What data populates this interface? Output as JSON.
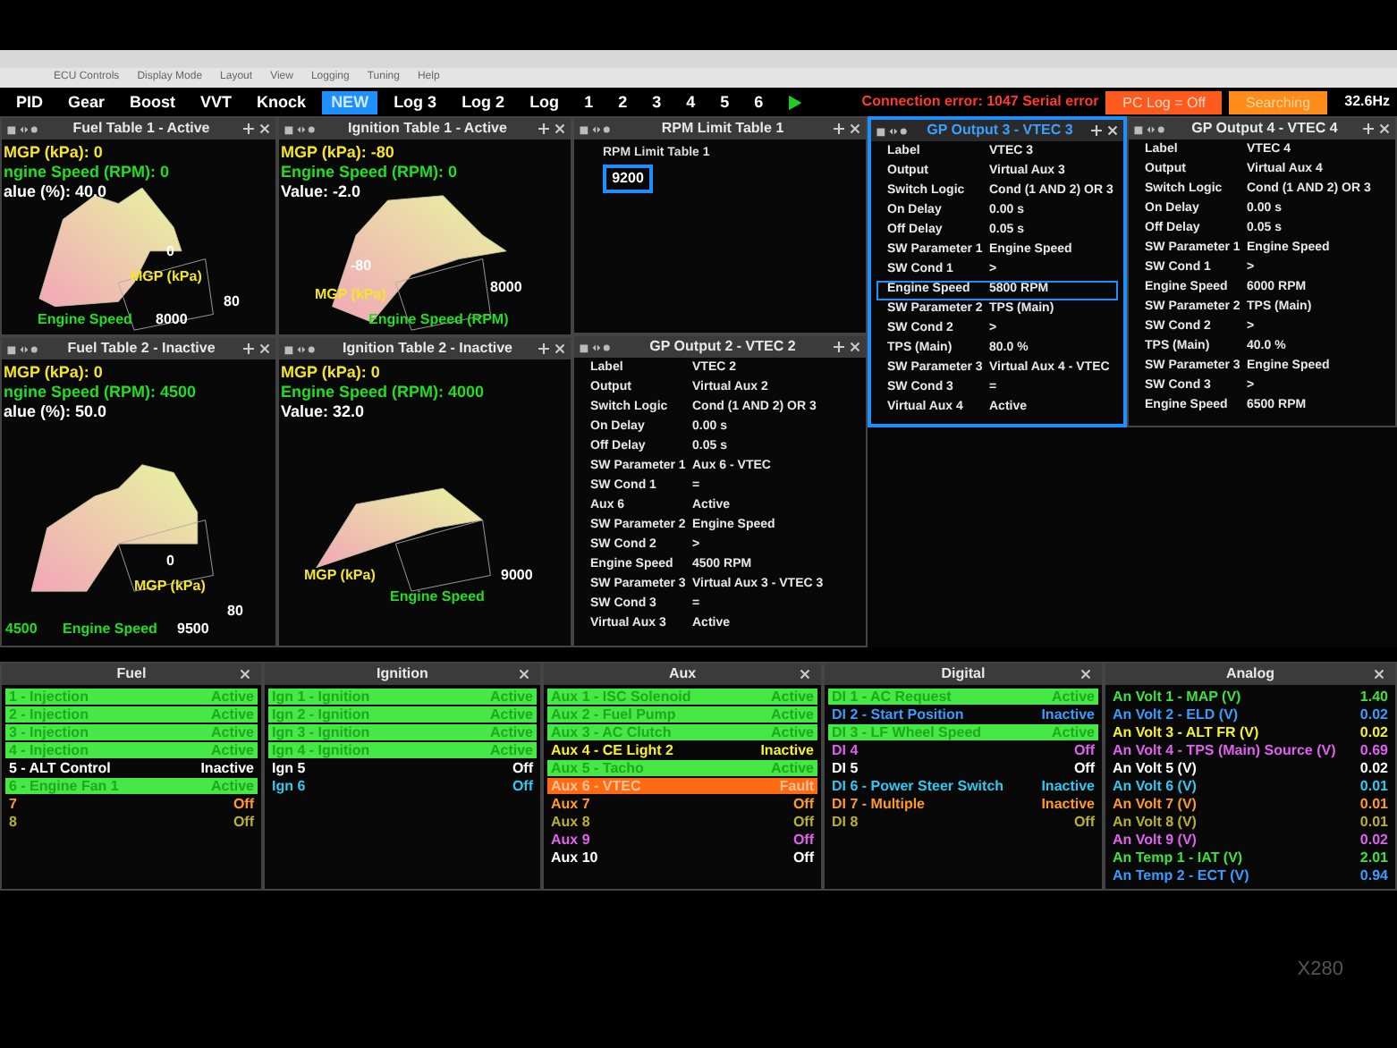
{
  "menu_bar": {
    "items": [
      "ECU Controls",
      "Display Mode",
      "Layout",
      "View",
      "Logging",
      "Tuning",
      "Help"
    ]
  },
  "toolbar": {
    "tabs": [
      {
        "label": "PID",
        "selected": false
      },
      {
        "label": "Gear",
        "selected": false
      },
      {
        "label": "Boost",
        "selected": false
      },
      {
        "label": "VVT",
        "selected": false
      },
      {
        "label": "Knock",
        "selected": false
      },
      {
        "label": "NEW",
        "selected": true
      },
      {
        "label": "Log 3",
        "selected": false
      },
      {
        "label": "Log 2",
        "selected": false
      },
      {
        "label": "Log",
        "selected": false
      },
      {
        "label": "1",
        "selected": false
      },
      {
        "label": "2",
        "selected": false
      },
      {
        "label": "3",
        "selected": false
      },
      {
        "label": "4",
        "selected": false
      },
      {
        "label": "5",
        "selected": false
      },
      {
        "label": "6",
        "selected": false
      }
    ],
    "connection_error": "Connection error: 1047 Serial error",
    "pc_log": "PC Log = Off",
    "search_status": "Searching",
    "rate": "32.6Hz"
  },
  "chart_panels": [
    {
      "title": "Fuel Table 1 - Active",
      "readouts": [
        {
          "kind": "mgp",
          "text": "MGP (kPa): 0"
        },
        {
          "kind": "rpm",
          "text": "ngine Speed (RPM): 0"
        },
        {
          "kind": "value",
          "text": "alue (%): 40.0"
        }
      ],
      "axis_labels": [
        {
          "kind": "tick",
          "text": "0"
        },
        {
          "kind": "mgp",
          "text": "MGP (kPa)"
        },
        {
          "kind": "tick",
          "text": "80"
        },
        {
          "kind": "rpm",
          "text": "Engine Speed"
        },
        {
          "kind": "tick",
          "text": "8000"
        }
      ]
    },
    {
      "title": "Ignition Table 1 - Active",
      "readouts": [
        {
          "kind": "mgp",
          "text": "MGP (kPa): -80"
        },
        {
          "kind": "rpm",
          "text": "Engine Speed (RPM): 0"
        },
        {
          "kind": "value",
          "text": "Value: -2.0"
        }
      ],
      "axis_labels": [
        {
          "kind": "tick",
          "text": "-80"
        },
        {
          "kind": "mgp",
          "text": "MGP (kPa)"
        },
        {
          "kind": "tick",
          "text": "8000"
        },
        {
          "kind": "rpm",
          "text": "Engine Speed (RPM)"
        }
      ]
    },
    {
      "title": "Fuel Table 2 - Inactive",
      "readouts": [
        {
          "kind": "mgp",
          "text": "MGP (kPa): 0"
        },
        {
          "kind": "rpm",
          "text": "ngine Speed (RPM): 4500"
        },
        {
          "kind": "value",
          "text": "alue (%): 50.0"
        }
      ],
      "axis_labels": [
        {
          "kind": "tick",
          "text": "0"
        },
        {
          "kind": "mgp",
          "text": "MGP (kPa)"
        },
        {
          "kind": "tick",
          "text": "80"
        },
        {
          "kind": "rpm",
          "text": "4500"
        },
        {
          "kind": "rpm",
          "text": "Engine Speed"
        },
        {
          "kind": "tick",
          "text": "9500"
        }
      ]
    },
    {
      "title": "Ignition Table 2 - Inactive",
      "readouts": [
        {
          "kind": "mgp",
          "text": "MGP (kPa): 0"
        },
        {
          "kind": "rpm",
          "text": "Engine Speed (RPM): 4000"
        },
        {
          "kind": "value",
          "text": "Value: 32.0"
        }
      ],
      "axis_labels": [
        {
          "kind": "mgp",
          "text": "MGP (kPa)"
        },
        {
          "kind": "rpm",
          "text": "Engine Speed"
        },
        {
          "kind": "tick",
          "text": "9000"
        }
      ]
    }
  ],
  "rpm_limit": {
    "title": "RPM Limit Table 1",
    "label": "RPM Limit Table 1",
    "value": "9200"
  },
  "gp_outputs": [
    {
      "title": "GP Output 2 - VTEC 2",
      "selected": false,
      "rows": [
        {
          "label": "Label",
          "value": "VTEC 2",
          "selected": false
        },
        {
          "label": "Output",
          "value": "Virtual Aux 2",
          "selected": false
        },
        {
          "label": "Switch Logic",
          "value": "Cond (1 AND 2) OR 3",
          "selected": false
        },
        {
          "label": "On Delay",
          "value": "0.00 s",
          "selected": false
        },
        {
          "label": "Off Delay",
          "value": "0.05 s",
          "selected": false
        },
        {
          "label": "SW Parameter 1",
          "value": "Aux 6 - VTEC",
          "selected": false
        },
        {
          "label": "SW Cond 1",
          "value": "=",
          "selected": false
        },
        {
          "label": "Aux 6",
          "value": "Active",
          "selected": false
        },
        {
          "label": "SW Parameter 2",
          "value": "Engine Speed",
          "selected": false
        },
        {
          "label": "SW Cond 2",
          "value": ">",
          "selected": false
        },
        {
          "label": "Engine Speed",
          "value": "4500 RPM",
          "selected": false
        },
        {
          "label": "SW Parameter 3",
          "value": "Virtual Aux 3 - VTEC 3",
          "selected": false
        },
        {
          "label": "SW Cond 3",
          "value": "=",
          "selected": false
        },
        {
          "label": "Virtual Aux 3",
          "value": "Active",
          "selected": false
        }
      ]
    },
    {
      "title": "GP Output 3 - VTEC 3",
      "selected": true,
      "rows": [
        {
          "label": "Label",
          "value": "VTEC 3",
          "selected": false
        },
        {
          "label": "Output",
          "value": "Virtual Aux 3",
          "selected": false
        },
        {
          "label": "Switch Logic",
          "value": "Cond (1 AND 2) OR 3",
          "selected": false
        },
        {
          "label": "On Delay",
          "value": "0.00 s",
          "selected": false
        },
        {
          "label": "Off Delay",
          "value": "0.05 s",
          "selected": false
        },
        {
          "label": "SW Parameter 1",
          "value": "Engine Speed",
          "selected": false
        },
        {
          "label": "SW Cond 1",
          "value": ">",
          "selected": false
        },
        {
          "label": "Engine Speed",
          "value": "5800 RPM",
          "selected": true
        },
        {
          "label": "SW Parameter 2",
          "value": "TPS (Main)",
          "selected": false
        },
        {
          "label": "SW Cond 2",
          "value": ">",
          "selected": false
        },
        {
          "label": "TPS (Main)",
          "value": "80.0 %",
          "selected": false
        },
        {
          "label": "SW Parameter 3",
          "value": "Virtual Aux 4 - VTEC",
          "selected": false
        },
        {
          "label": "SW Cond 3",
          "value": "=",
          "selected": false
        },
        {
          "label": "Virtual Aux 4",
          "value": "Active",
          "selected": false
        }
      ]
    },
    {
      "title": "GP Output 4 - VTEC 4",
      "selected": false,
      "rows": [
        {
          "label": "Label",
          "value": "VTEC 4",
          "selected": false
        },
        {
          "label": "Output",
          "value": "Virtual Aux 4",
          "selected": false
        },
        {
          "label": "Switch Logic",
          "value": "Cond (1 AND 2) OR 3",
          "selected": false
        },
        {
          "label": "On Delay",
          "value": "0.00 s",
          "selected": false
        },
        {
          "label": "Off Delay",
          "value": "0.05 s",
          "selected": false
        },
        {
          "label": "SW Parameter 1",
          "value": "Engine Speed",
          "selected": false
        },
        {
          "label": "SW Cond 1",
          "value": ">",
          "selected": false
        },
        {
          "label": "Engine Speed",
          "value": "6000 RPM",
          "selected": false
        },
        {
          "label": "SW Parameter 2",
          "value": "TPS (Main)",
          "selected": false
        },
        {
          "label": "SW Cond 2",
          "value": ">",
          "selected": false
        },
        {
          "label": "TPS (Main)",
          "value": "40.0 %",
          "selected": false
        },
        {
          "label": "SW Parameter 3",
          "value": "Engine Speed",
          "selected": false
        },
        {
          "label": "SW Cond 3",
          "value": ">",
          "selected": false
        },
        {
          "label": "Engine Speed",
          "value": "6500 RPM",
          "selected": false
        }
      ]
    }
  ],
  "status_panels": [
    {
      "title": "Fuel",
      "items": [
        {
          "name": "1 - Injection",
          "status": "Active",
          "kind": "active"
        },
        {
          "name": "2 - Injection",
          "status": "Active",
          "kind": "active"
        },
        {
          "name": "3 - Injection",
          "status": "Active",
          "kind": "active"
        },
        {
          "name": "4 - Injection",
          "status": "Active",
          "kind": "active"
        },
        {
          "name": "5 - ALT Control",
          "status": "Inactive",
          "kind": "plain",
          "color": "#ffffff"
        },
        {
          "name": "6 - Engine Fan 1",
          "status": "Active",
          "kind": "active"
        },
        {
          "name": "7",
          "status": "Off",
          "kind": "plain",
          "color": "#ff9a2a"
        },
        {
          "name": "8",
          "status": "Off",
          "kind": "plain",
          "color": "#b8b030"
        }
      ]
    },
    {
      "title": "Ignition",
      "items": [
        {
          "name": "Ign 1 - Ignition",
          "status": "Active",
          "kind": "active"
        },
        {
          "name": "Ign 2 - Ignition",
          "status": "Active",
          "kind": "active"
        },
        {
          "name": "Ign 3 - Ignition",
          "status": "Active",
          "kind": "active"
        },
        {
          "name": "Ign 4 - Ignition",
          "status": "Active",
          "kind": "active"
        },
        {
          "name": "Ign 5",
          "status": "Off",
          "kind": "plain",
          "color": "#ffffff"
        },
        {
          "name": "Ign 6",
          "status": "Off",
          "kind": "plain",
          "color": "#30c8f0"
        }
      ]
    },
    {
      "title": "Aux",
      "items": [
        {
          "name": "Aux 1 - ISC Solenoid",
          "status": "Active",
          "kind": "active"
        },
        {
          "name": "Aux 2 - Fuel Pump",
          "status": "Active",
          "kind": "active"
        },
        {
          "name": "Aux 3 - AC Clutch",
          "status": "Active",
          "kind": "active"
        },
        {
          "name": "Aux 4 - CE Light 2",
          "status": "Inactive",
          "kind": "plain",
          "color": "#f5f030"
        },
        {
          "name": "Aux 5 - Tacho",
          "status": "Active",
          "kind": "active"
        },
        {
          "name": "Aux 6 - VTEC",
          "status": "Fault",
          "kind": "fault"
        },
        {
          "name": "Aux 7",
          "status": "Off",
          "kind": "plain",
          "color": "#ff9a2a"
        },
        {
          "name": "Aux 8",
          "status": "Off",
          "kind": "plain",
          "color": "#b8b030"
        },
        {
          "name": "Aux 9",
          "status": "Off",
          "kind": "plain",
          "color": "#e060f0"
        },
        {
          "name": "Aux 10",
          "status": "Off",
          "kind": "plain",
          "color": "#ffffff"
        }
      ]
    },
    {
      "title": "Digital",
      "items": [
        {
          "name": "DI 1 - AC Request",
          "status": "Active",
          "kind": "active"
        },
        {
          "name": "DI 2 - Start Position",
          "status": "Inactive",
          "kind": "plain",
          "color": "#3a9cff"
        },
        {
          "name": "DI 3 - LF Wheel Speed",
          "status": "Active",
          "kind": "active"
        },
        {
          "name": "DI 4",
          "status": "Off",
          "kind": "plain",
          "color": "#e060f0"
        },
        {
          "name": "DI 5",
          "status": "Off",
          "kind": "plain",
          "color": "#ffffff"
        },
        {
          "name": "DI 6 - Power Steer Switch",
          "status": "Inactive",
          "kind": "plain",
          "color": "#30c8f0"
        },
        {
          "name": "DI 7 - Multiple",
          "status": "Inactive",
          "kind": "plain",
          "color": "#ff9a2a"
        },
        {
          "name": "DI 8",
          "status": "Off",
          "kind": "plain",
          "color": "#b8b030"
        }
      ]
    },
    {
      "title": "Analog",
      "items": [
        {
          "name": "An Volt 1 - MAP (V)",
          "status": "1.40",
          "kind": "plain",
          "color": "#40e040"
        },
        {
          "name": "An Volt 2 - ELD (V)",
          "status": "0.02",
          "kind": "plain",
          "color": "#3a9cff"
        },
        {
          "name": "An Volt 3 - ALT FR (V)",
          "status": "0.02",
          "kind": "plain",
          "color": "#f5f030"
        },
        {
          "name": "An Volt 4 - TPS (Main) Source (V)",
          "status": "0.69",
          "kind": "plain",
          "color": "#e060f0"
        },
        {
          "name": "An Volt 5 (V)",
          "status": "0.02",
          "kind": "plain",
          "color": "#ffffff"
        },
        {
          "name": "An Volt 6 (V)",
          "status": "0.01",
          "kind": "plain",
          "color": "#30c8f0"
        },
        {
          "name": "An Volt 7 (V)",
          "status": "0.01",
          "kind": "plain",
          "color": "#ff9a2a"
        },
        {
          "name": "An Volt 8 (V)",
          "status": "0.01",
          "kind": "plain",
          "color": "#b8b030"
        },
        {
          "name": "An Volt 9 (V)",
          "status": "0.02",
          "kind": "plain",
          "color": "#e060f0"
        },
        {
          "name": "An Temp 1 - IAT (V)",
          "status": "2.01",
          "kind": "plain",
          "color": "#40e040"
        },
        {
          "name": "An Temp 2 - ECT (V)",
          "status": "0.94",
          "kind": "plain",
          "color": "#3a9cff"
        }
      ]
    }
  ],
  "bezel": {
    "model": "X280"
  }
}
